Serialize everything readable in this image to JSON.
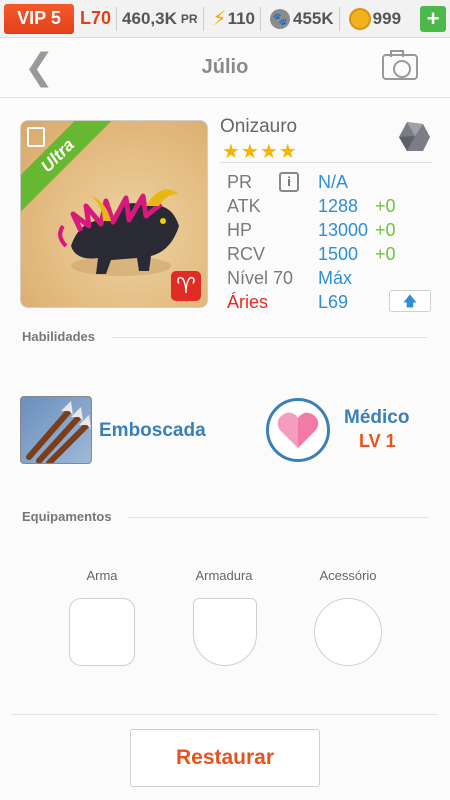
{
  "topbar": {
    "vip": "VIP 5",
    "level": "L70",
    "pr_value": "460,3K",
    "pr_label": "PR",
    "stamina": "110",
    "paw_currency": "455K",
    "coins": "999",
    "plus": "+"
  },
  "header": {
    "title": "Júlio"
  },
  "monster": {
    "name": "Onizauro",
    "rarity": "Ultra",
    "stars": "★★★★",
    "zodiac_symbol": "♈",
    "stats": {
      "pr_label": "PR",
      "pr_value": "N/A",
      "atk_label": "ATK",
      "atk_value": "1288",
      "atk_bonus": "+0",
      "hp_label": "HP",
      "hp_value": "13000",
      "hp_bonus": "+0",
      "rcv_label": "RCV",
      "rcv_value": "1500",
      "rcv_bonus": "+0",
      "level_label": "Nível 70",
      "level_value": "Máx",
      "sign_label": "Áries",
      "sign_value": "L69"
    }
  },
  "abilities": {
    "section_title": "Habilidades",
    "skill_name": "Emboscada",
    "leader_name": "Médico",
    "leader_level": "LV 1"
  },
  "equipment": {
    "section_title": "Equipamentos",
    "weapon": "Arma",
    "armor": "Armadura",
    "accessory": "Acessório"
  },
  "footer": {
    "restore_label": "Restaurar"
  },
  "colors": {
    "accent_orange": "#e5541d",
    "stat_blue": "#2f8fd5",
    "bonus_green": "#6ec23d",
    "ultra_green": "#65b82f",
    "zodiac_red": "#e12b25"
  }
}
